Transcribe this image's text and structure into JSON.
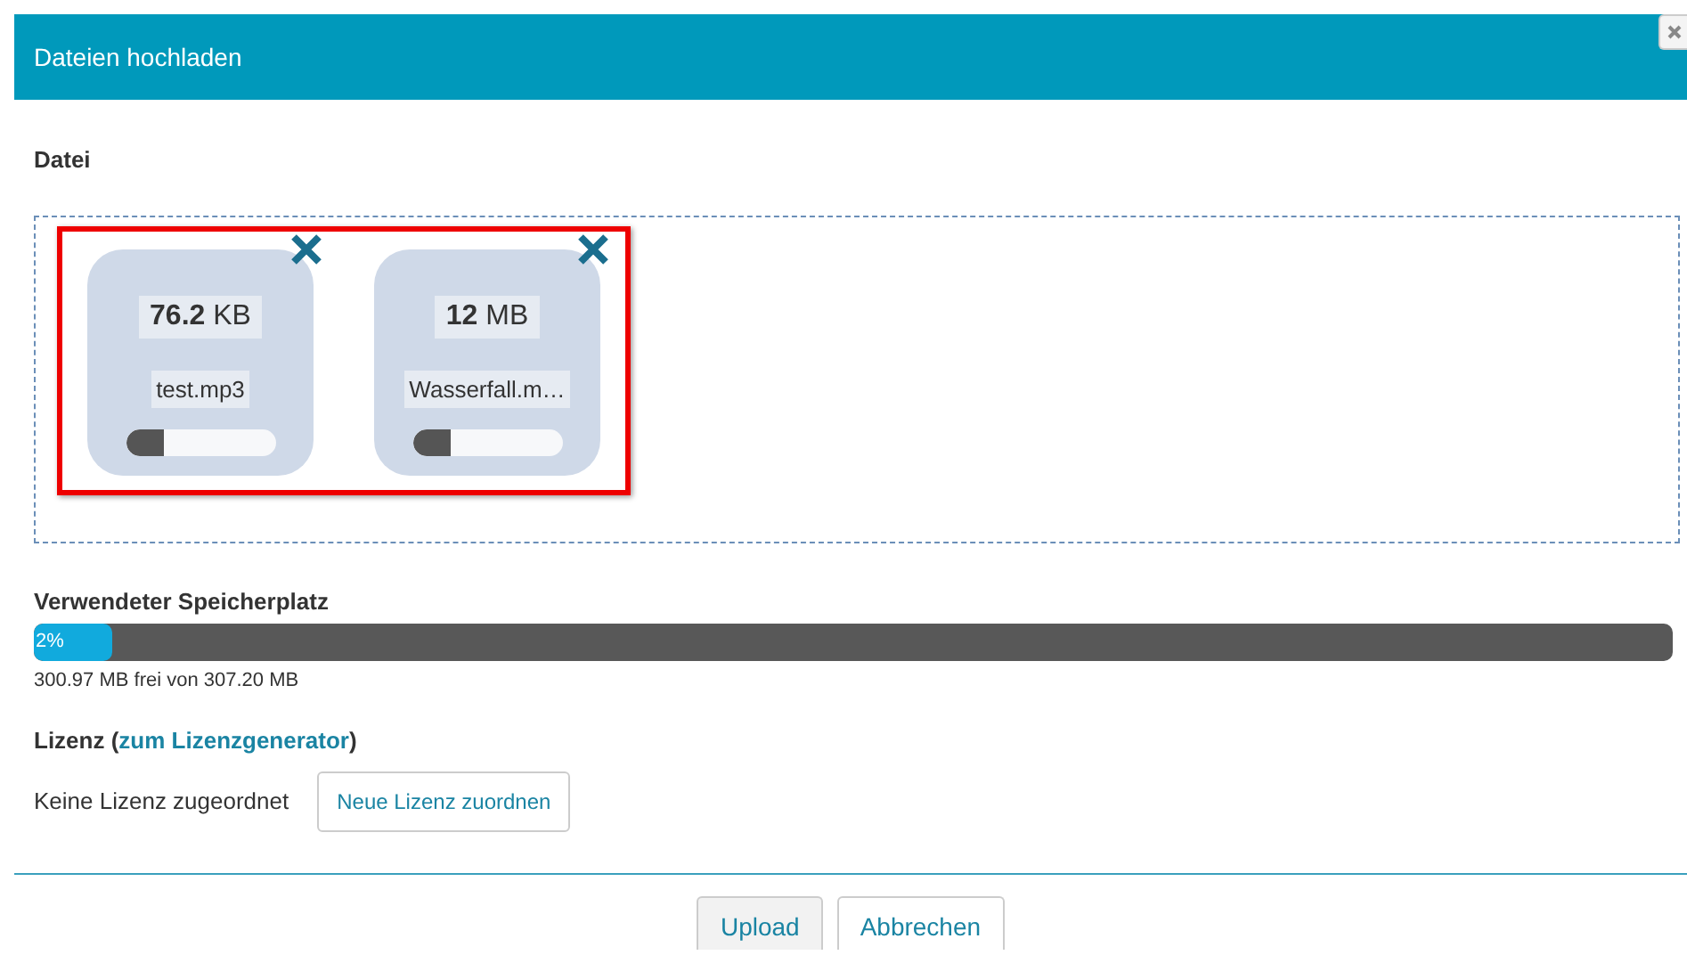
{
  "dialog": {
    "title": "Dateien hochladen",
    "close_button": true
  },
  "file_section": {
    "label": "Datei",
    "highlighted": true,
    "files": [
      {
        "size": "**76.2** KB",
        "name": "test.mp3",
        "level": 0.25
      },
      {
        "size": "**12** MB",
        "name": "Wasserfall.m…",
        "level": 0.25
      }
    ]
  },
  "storage": {
    "label": "Verwendeter Speicherplatz",
    "level": 0.048,
    "percent": "2%",
    "summary": "300.97 MB frei von 307.20 MB"
  },
  "license": {
    "label": "Lizenz (",
    "link": "zum Lizenzgenerator",
    "label_end": ")",
    "status": "Keine Lizenz zugeordnet",
    "button": "Neue Lizenz zuordnen"
  },
  "buttons": [
    {
      "label": "Upload",
      "kind": "primary"
    },
    {
      "label": "Abbrechen",
      "kind": "secondary"
    }
  ]
}
